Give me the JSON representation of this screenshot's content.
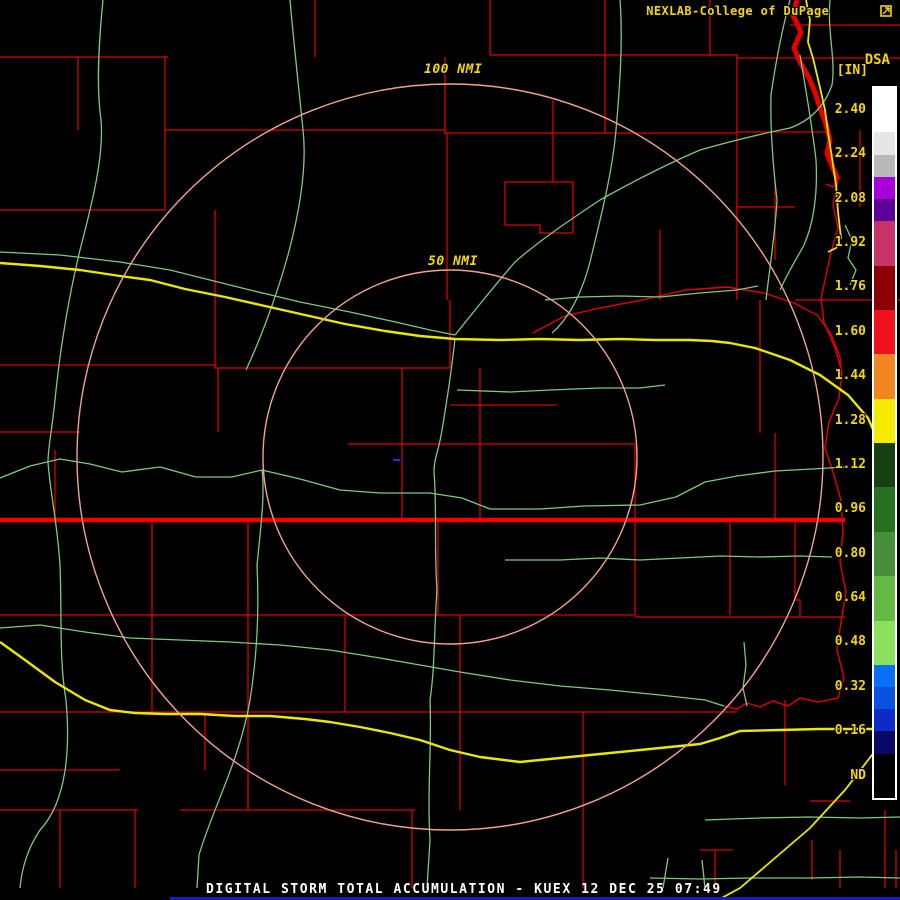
{
  "header": {
    "brand": "NEXLAB-College of DuPage"
  },
  "product": {
    "code": "DSA",
    "units": "[IN]"
  },
  "range_rings": {
    "outer_label": "100 NMI",
    "inner_label": "50 NMI"
  },
  "legend": {
    "labels": [
      "2.40",
      "2.24",
      "2.08",
      "1.92",
      "1.76",
      "1.60",
      "1.44",
      "1.28",
      "1.12",
      "0.96",
      "0.80",
      "0.64",
      "0.48",
      "0.32",
      "0.16",
      "ND"
    ],
    "segments": [
      "#FFFFFF",
      "#E6E6E6",
      "#B8B8B8",
      "#A800D8",
      "#5C0099",
      "#C63366",
      "#8B0000",
      "#F2101D",
      "#F08522",
      "#F5EB00",
      "#15400F",
      "#26701F",
      "#478F38",
      "#64B945",
      "#8BE060",
      "#0870F8",
      "#0B51E0",
      "#0C2BC8",
      "#0A0A66",
      "#000000"
    ]
  },
  "footer": {
    "title": "DIGITAL STORM TOTAL ACCUMULATION - KUEX 12 DEC 25 07:49"
  },
  "colors": {
    "county": "#DC0000",
    "state_line": "#F40000",
    "river_red": "#E60000",
    "road_green": "#7FC87F",
    "road_yellow": "#E9E900",
    "range_ring": "#F0A48C",
    "text_yellow": "#F5D800",
    "title_white": "#FFFFFF",
    "echo_blue": "#2233CC",
    "echo_dark_blue": "#000F90",
    "bottom_strip": "#1818C8",
    "background": "#000000"
  }
}
